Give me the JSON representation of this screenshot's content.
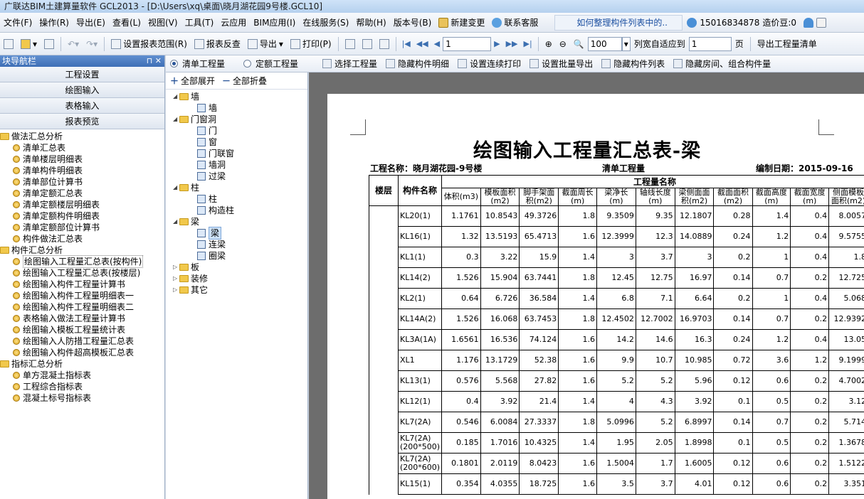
{
  "window": {
    "title": "广联达BIM土建算量软件 GCL2013 - [D:\\Users\\xq\\桌面\\晓月湖花园9号楼.GCL10]"
  },
  "menubar": {
    "items": [
      "文件(F)",
      "操作(R)",
      "导出(E)",
      "查看(L)",
      "视图(V)",
      "工具(T)",
      "云应用",
      "BIM应用(I)",
      "在线服务(S)",
      "帮助(H)",
      "版本号(B)"
    ],
    "new_change": "新建变更",
    "support": "联系客服",
    "news": "如何整理构件列表中的..",
    "phone": "15016834878",
    "beans": "造价豆:0"
  },
  "toolbar1": {
    "report_range": "设置报表范围(R)",
    "report_check": "报表反查",
    "export": "导出",
    "print": "打印(P)",
    "page_value": "1",
    "zoom_value": "100",
    "col_width_label": "列宽自适应到",
    "col_width_value": "1",
    "page_unit": "页",
    "export_list": "导出工程量清单"
  },
  "leftpanel": {
    "header": "块导航栏",
    "header_buttons": "ₐ ×",
    "nav_buttons": [
      "工程设置",
      "绘图输入",
      "表格输入",
      "报表预览"
    ],
    "groups": [
      {
        "label": "做法汇总分析",
        "items": [
          "清单汇总表",
          "清单楼层明细表",
          "清单构件明细表",
          "清单部位计算书",
          "清单定额汇总表",
          "清单定额楼层明细表",
          "清单定额构件明细表",
          "清单定额部位计算书",
          "构件做法汇总表"
        ]
      },
      {
        "label": "构件汇总分析",
        "items": [
          "绘图输入工程量汇总表(按构件)",
          "绘图输入工程量汇总表(按楼层)",
          "绘图输入构件工程量计算书",
          "绘图输入构件工程量明细表一",
          "绘图输入构件工程量明细表二",
          "表格输入做法工程量计算书",
          "绘图输入模板工程量统计表",
          "绘图输入人防措工程量汇总表",
          "绘图输入构件超高模板汇总表"
        ]
      },
      {
        "label": "指标汇总分析",
        "items": [
          "单方混凝土指标表",
          "工程综合指标表",
          "混凝土标号指标表"
        ]
      }
    ]
  },
  "toolbar2": {
    "radio_bill": "清单工程量",
    "radio_quota": "定额工程量",
    "select_qty": "选择工程量",
    "hide_detail": "隐藏构件明细",
    "continuous_print": "设置连续打印",
    "batch_export": "设置批量导出",
    "hide_list": "隐藏构件列表",
    "hide_rooms": "隐藏房间、组合构件量"
  },
  "midpanel": {
    "expand_all": "全部展开",
    "collapse_all": "全部折叠",
    "tree": [
      {
        "label": "墙",
        "children": [
          "墙"
        ]
      },
      {
        "label": "门窗洞",
        "children": [
          "门",
          "窗",
          "门联窗",
          "墙洞",
          "过梁"
        ]
      },
      {
        "label": "柱",
        "children": [
          "柱",
          "构造柱"
        ]
      },
      {
        "label": "梁",
        "children": [
          "梁",
          "连梁",
          "圈梁"
        ]
      },
      {
        "label": "板",
        "children": []
      },
      {
        "label": "装修",
        "children": []
      },
      {
        "label": "其它",
        "children": []
      }
    ]
  },
  "report": {
    "title": "绘图输入工程量汇总表-梁",
    "project_name": "工程名称：晓月湖花园-9号楼",
    "qty_type": "清单工程量",
    "date": "编制日期：2015-09-16",
    "col_floor": "楼层",
    "col_name": "构件名称",
    "group_header": "工程量名称",
    "columns": [
      "体积(m3)",
      "模板面积(m2)",
      "脚手架面积(m2)",
      "截面周长(m)",
      "梁净长(m)",
      "轴线长度(m)",
      "梁侧面面积(m2)",
      "截面面积(m2)",
      "截面高度(m)",
      "截面宽度(m)",
      "侧面模板面积(m2)"
    ],
    "rows": [
      {
        "name": "KL20(1)",
        "values": [
          "1.1761",
          "10.8543",
          "49.3726",
          "1.8",
          "9.3509",
          "9.35",
          "12.1807",
          "0.28",
          "1.4",
          "0.4",
          "8.0057"
        ]
      },
      {
        "name": "KL16(1)",
        "values": [
          "1.32",
          "13.5193",
          "65.4713",
          "1.6",
          "12.3999",
          "12.3",
          "14.0889",
          "0.24",
          "1.2",
          "0.4",
          "9.5755"
        ]
      },
      {
        "name": "KL1(1)",
        "values": [
          "0.3",
          "3.22",
          "15.9",
          "1.4",
          "3",
          "3.7",
          "3",
          "0.2",
          "1",
          "0.4",
          "1.8"
        ]
      },
      {
        "name": "KL14(2)",
        "values": [
          "1.526",
          "15.904",
          "63.7441",
          "1.8",
          "12.45",
          "12.75",
          "16.97",
          "0.14",
          "0.7",
          "0.2",
          "12.725"
        ]
      },
      {
        "name": "KL2(1)",
        "values": [
          "0.64",
          "6.726",
          "36.584",
          "1.4",
          "6.8",
          "7.1",
          "6.64",
          "0.2",
          "1",
          "0.4",
          "5.068"
        ]
      },
      {
        "name": "KL14A(2)",
        "values": [
          "1.526",
          "16.068",
          "63.7453",
          "1.8",
          "12.4502",
          "12.7002",
          "16.9703",
          "0.14",
          "0.7",
          "0.2",
          "12.9392"
        ]
      },
      {
        "name": "KL3A(1A)",
        "values": [
          "1.6561",
          "16.536",
          "74.124",
          "1.6",
          "14.2",
          "14.6",
          "16.3",
          "0.24",
          "1.2",
          "0.4",
          "13.05"
        ]
      },
      {
        "name": "XL1",
        "values": [
          "1.176",
          "13.1729",
          "52.38",
          "1.6",
          "9.9",
          "10.7",
          "10.985",
          "0.72",
          "3.6",
          "1.2",
          "9.1999"
        ]
      },
      {
        "name": "KL13(1)",
        "values": [
          "0.576",
          "5.568",
          "27.82",
          "1.6",
          "5.2",
          "5.2",
          "5.96",
          "0.12",
          "0.6",
          "0.2",
          "4.7002"
        ]
      },
      {
        "name": "KL12(1)",
        "values": [
          "0.4",
          "3.92",
          "21.4",
          "1.4",
          "4",
          "4.3",
          "3.92",
          "0.1",
          "0.5",
          "0.2",
          "3.12"
        ]
      },
      {
        "name": "KL7(2A)",
        "values": [
          "0.546",
          "6.0084",
          "27.3337",
          "1.8",
          "5.0996",
          "5.2",
          "6.8997",
          "0.14",
          "0.7",
          "0.2",
          "5.714"
        ]
      },
      {
        "name": "KL7(2A)(200*500)",
        "values": [
          "0.185",
          "1.7016",
          "10.4325",
          "1.4",
          "1.95",
          "2.05",
          "1.8998",
          "0.1",
          "0.5",
          "0.2",
          "1.3678"
        ]
      },
      {
        "name": "KL7(2A)(200*600)",
        "values": [
          "0.1801",
          "2.0119",
          "8.0423",
          "1.6",
          "1.5004",
          "1.7",
          "1.6005",
          "0.12",
          "0.6",
          "0.2",
          "1.5122"
        ]
      },
      {
        "name": "KL15(1)",
        "values": [
          "0.354",
          "4.0355",
          "18.725",
          "1.6",
          "3.5",
          "3.7",
          "4.01",
          "0.12",
          "0.6",
          "0.2",
          "3.351"
        ]
      }
    ]
  },
  "colors": {
    "accent": "#3e6fb6",
    "folder": "#f1c84b",
    "selection": "#cde2f8"
  }
}
